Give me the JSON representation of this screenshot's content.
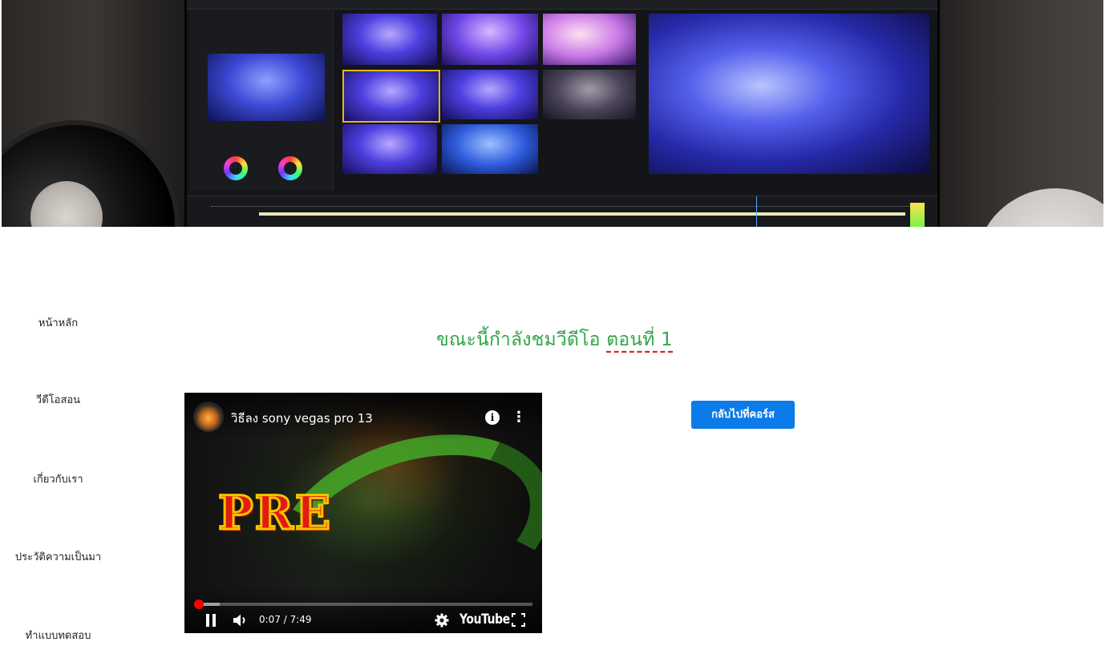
{
  "nav": {
    "items": [
      {
        "label": "หน้าหลัก"
      },
      {
        "label": "วีดีโอสอน"
      },
      {
        "label": "เกี่ยวกับเรา"
      },
      {
        "label": "ประวัติความเป็นมา"
      },
      {
        "label": "ทำแบบทดสอบ"
      }
    ]
  },
  "main": {
    "heading_prefix": "ขณะนี้กำลังชมวีดีโอ",
    "heading_episode": "ตอนที่ 1",
    "back_button_label": "กลับไปที่คอร์ส"
  },
  "video": {
    "title": "วิธีลง sony vegas pro 13",
    "logo_text": "PRE",
    "time_display": "0:07 / 7:49",
    "progress_fraction": 0.015,
    "buffered_fraction": 0.075,
    "youtube_label": "YouTube"
  },
  "colors": {
    "heading_green": "#30a64a",
    "underline_red": "#d9232a",
    "button_blue": "#0b7bea",
    "progress_red": "#ff0000"
  },
  "icons": [
    "info-icon",
    "more-vert-icon",
    "pause-icon",
    "volume-icon",
    "gear-icon",
    "fullscreen-icon"
  ]
}
